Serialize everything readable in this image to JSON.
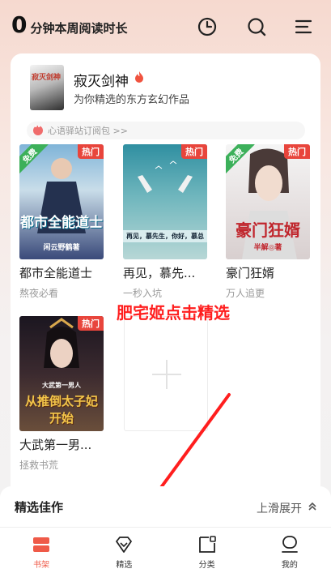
{
  "header": {
    "reading_minutes": "0",
    "reading_label": "分钟本周阅读时长",
    "icons": [
      "history-clock-icon",
      "search-icon",
      "menu-icon"
    ]
  },
  "featured": {
    "cover_text": "寂灭剑神",
    "title": "寂灭剑神",
    "subtitle": "为你精选的东方玄幻作品"
  },
  "promo": {
    "text": "心语驿站订阅包 >>"
  },
  "books": [
    {
      "title": "都市全能道士",
      "tag": "熬夜必看",
      "badge_hot": "热门",
      "badge_free": "免费",
      "cover_text": "都市全能道士",
      "cover_author": "闲云野鹤著"
    },
    {
      "title": "再见，慕先...",
      "tag": "一秒入坑",
      "badge_hot": "热门",
      "badge_free": "",
      "cover_text": "再见，慕先生，你好，慕总",
      "cover_author": ""
    },
    {
      "title": "豪门狂婿",
      "tag": "万人追更",
      "badge_hot": "热门",
      "badge_free": "免费",
      "cover_text": "豪门狂婿",
      "cover_author": "半解◎著"
    },
    {
      "title": "大武第一男...",
      "tag": "拯救书荒",
      "badge_hot": "热门",
      "badge_free": "",
      "cover_text": "从推倒太子妃开始",
      "cover_author": "大武第一男人"
    }
  ],
  "annotation": {
    "text": "肥宅姬点击精选",
    "color": "#ff1e1e"
  },
  "sheet": {
    "title": "精选佳作",
    "expand_label": "上滑展开"
  },
  "nav": {
    "items": [
      {
        "label": "书架",
        "icon": "bookshelf-icon",
        "active": true
      },
      {
        "label": "精选",
        "icon": "diamond-icon",
        "active": false
      },
      {
        "label": "分类",
        "icon": "category-icon",
        "active": false
      },
      {
        "label": "我的",
        "icon": "profile-icon",
        "active": false
      }
    ]
  },
  "colors": {
    "accent": "#ef5a48",
    "hot_badge": "#e8453c",
    "free_badge": "#3cb05a"
  }
}
